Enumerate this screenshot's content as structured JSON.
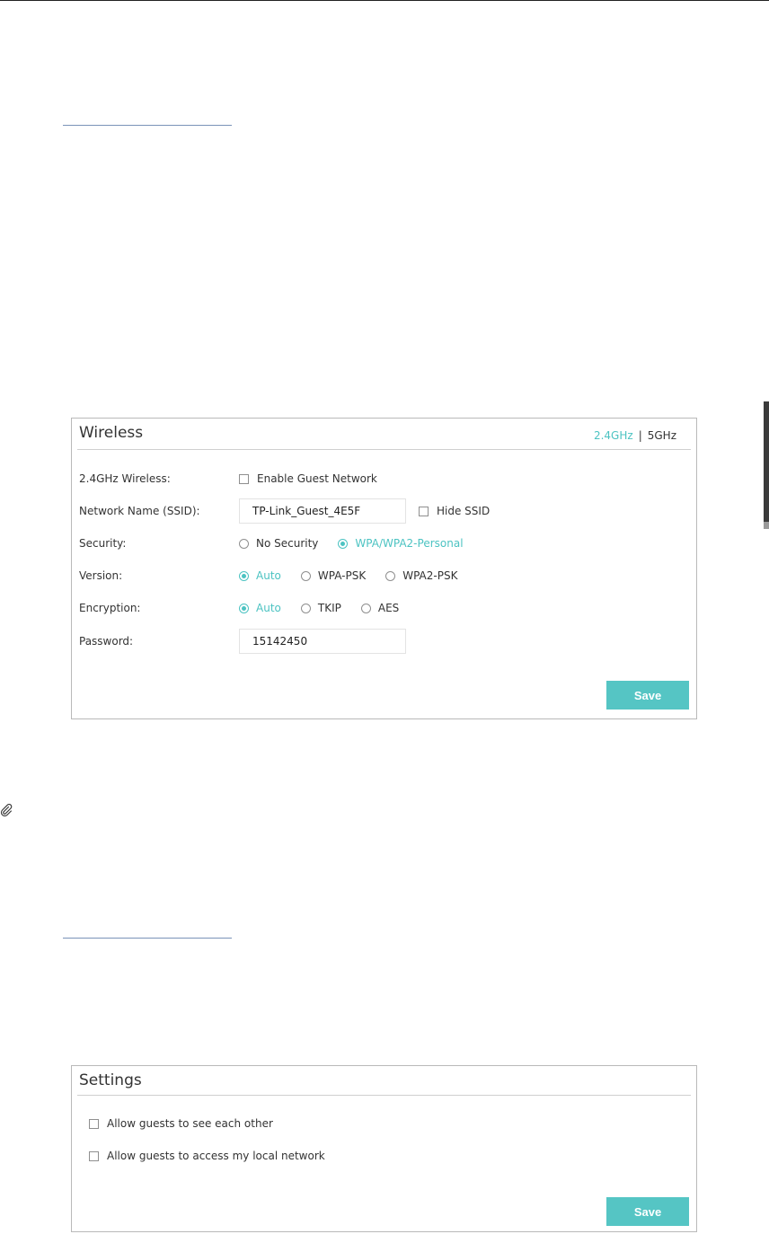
{
  "wireless": {
    "title": "Wireless",
    "bands": [
      {
        "label": "2.4GHz",
        "active": true
      },
      {
        "label": "5GHz",
        "active": false
      }
    ],
    "band_separator": "|",
    "rows": {
      "wireless": {
        "label": "2.4GHz Wireless:",
        "checkbox_label": "Enable Guest Network",
        "checked": false
      },
      "ssid": {
        "label": "Network Name (SSID):",
        "value": "TP-Link_Guest_4E5F",
        "hide_label": "Hide SSID",
        "hide_checked": false
      },
      "security": {
        "label": "Security:",
        "options": [
          "No Security",
          "WPA/WPA2-Personal"
        ],
        "selected": "WPA/WPA2-Personal"
      },
      "version": {
        "label": "Version:",
        "options": [
          "Auto",
          "WPA-PSK",
          "WPA2-PSK"
        ],
        "selected": "Auto"
      },
      "encryption": {
        "label": "Encryption:",
        "options": [
          "Auto",
          "TKIP",
          "AES"
        ],
        "selected": "Auto"
      },
      "password": {
        "label": "Password:",
        "value": "15142450"
      }
    },
    "save_label": "Save"
  },
  "settings": {
    "title": "Settings",
    "options": [
      {
        "label": "Allow guests to see each other",
        "checked": false
      },
      {
        "label": "Allow guests to access my local network",
        "checked": false
      }
    ],
    "save_label": "Save"
  },
  "colors": {
    "accent": "#4cc3c2",
    "button": "#55c5c4",
    "border": "#b9b9b9"
  },
  "icons": {
    "note": "paperclip-icon"
  }
}
